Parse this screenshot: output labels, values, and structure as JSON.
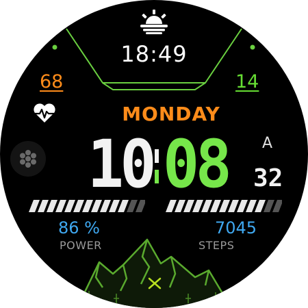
{
  "watchface": {
    "top": {
      "time": "18:49",
      "weather_icon": "sun-cloud-icon"
    },
    "left_value": "68",
    "right_value": "14",
    "heart_icon": "heart-rate-icon",
    "day": "MONDAY",
    "time": {
      "hour": "10",
      "minute": "08",
      "am_pm": "A",
      "seconds": "32"
    },
    "power": {
      "value": "86 %",
      "label": "POWER",
      "level": 0.86
    },
    "steps": {
      "value": "7045",
      "label": "STEPS"
    },
    "decor": {
      "mountains_icon": "mountains-icon",
      "logo_icon": "crossed-tools-icon"
    }
  },
  "colors": {
    "orange": "#ff8c1a",
    "green": "#76e64a",
    "blue": "#3fa8f0",
    "white": "#f2f2f2",
    "gray": "#9a9a9a"
  }
}
